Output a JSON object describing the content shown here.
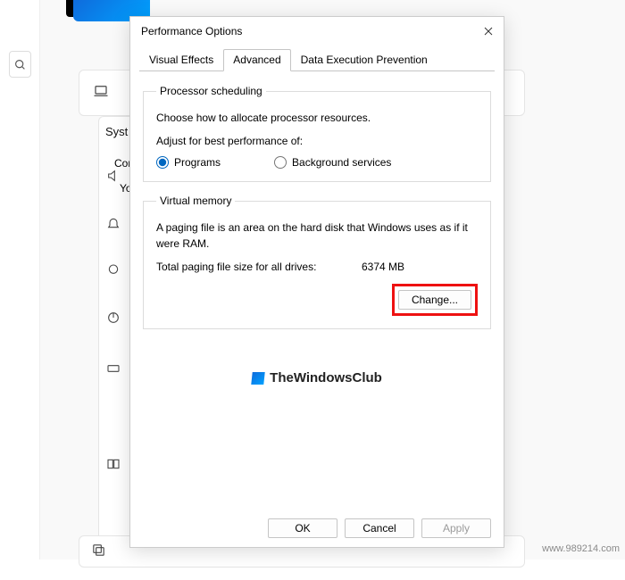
{
  "dialog": {
    "title": "Performance Options",
    "tabs": {
      "visual": "Visual Effects",
      "advanced": "Advanced",
      "dep": "Data Execution Prevention"
    },
    "processor": {
      "legend": "Processor scheduling",
      "desc": "Choose how to allocate processor resources.",
      "adjust": "Adjust for best performance of:",
      "programs": "Programs",
      "bgservices": "Background services"
    },
    "vm": {
      "legend": "Virtual memory",
      "desc": "A paging file is an area on the hard disk that Windows uses as if it were RAM.",
      "total_label": "Total paging file size for all drives:",
      "total_value": "6374 MB",
      "change": "Change..."
    },
    "footer": {
      "ok": "OK",
      "cancel": "Cancel",
      "apply": "Apply"
    }
  },
  "watermark": "TheWindowsClub",
  "underlay": {
    "syst": "Syst",
    "com": "Com",
    "yo": "Yo"
  },
  "site": "www.989214.com"
}
